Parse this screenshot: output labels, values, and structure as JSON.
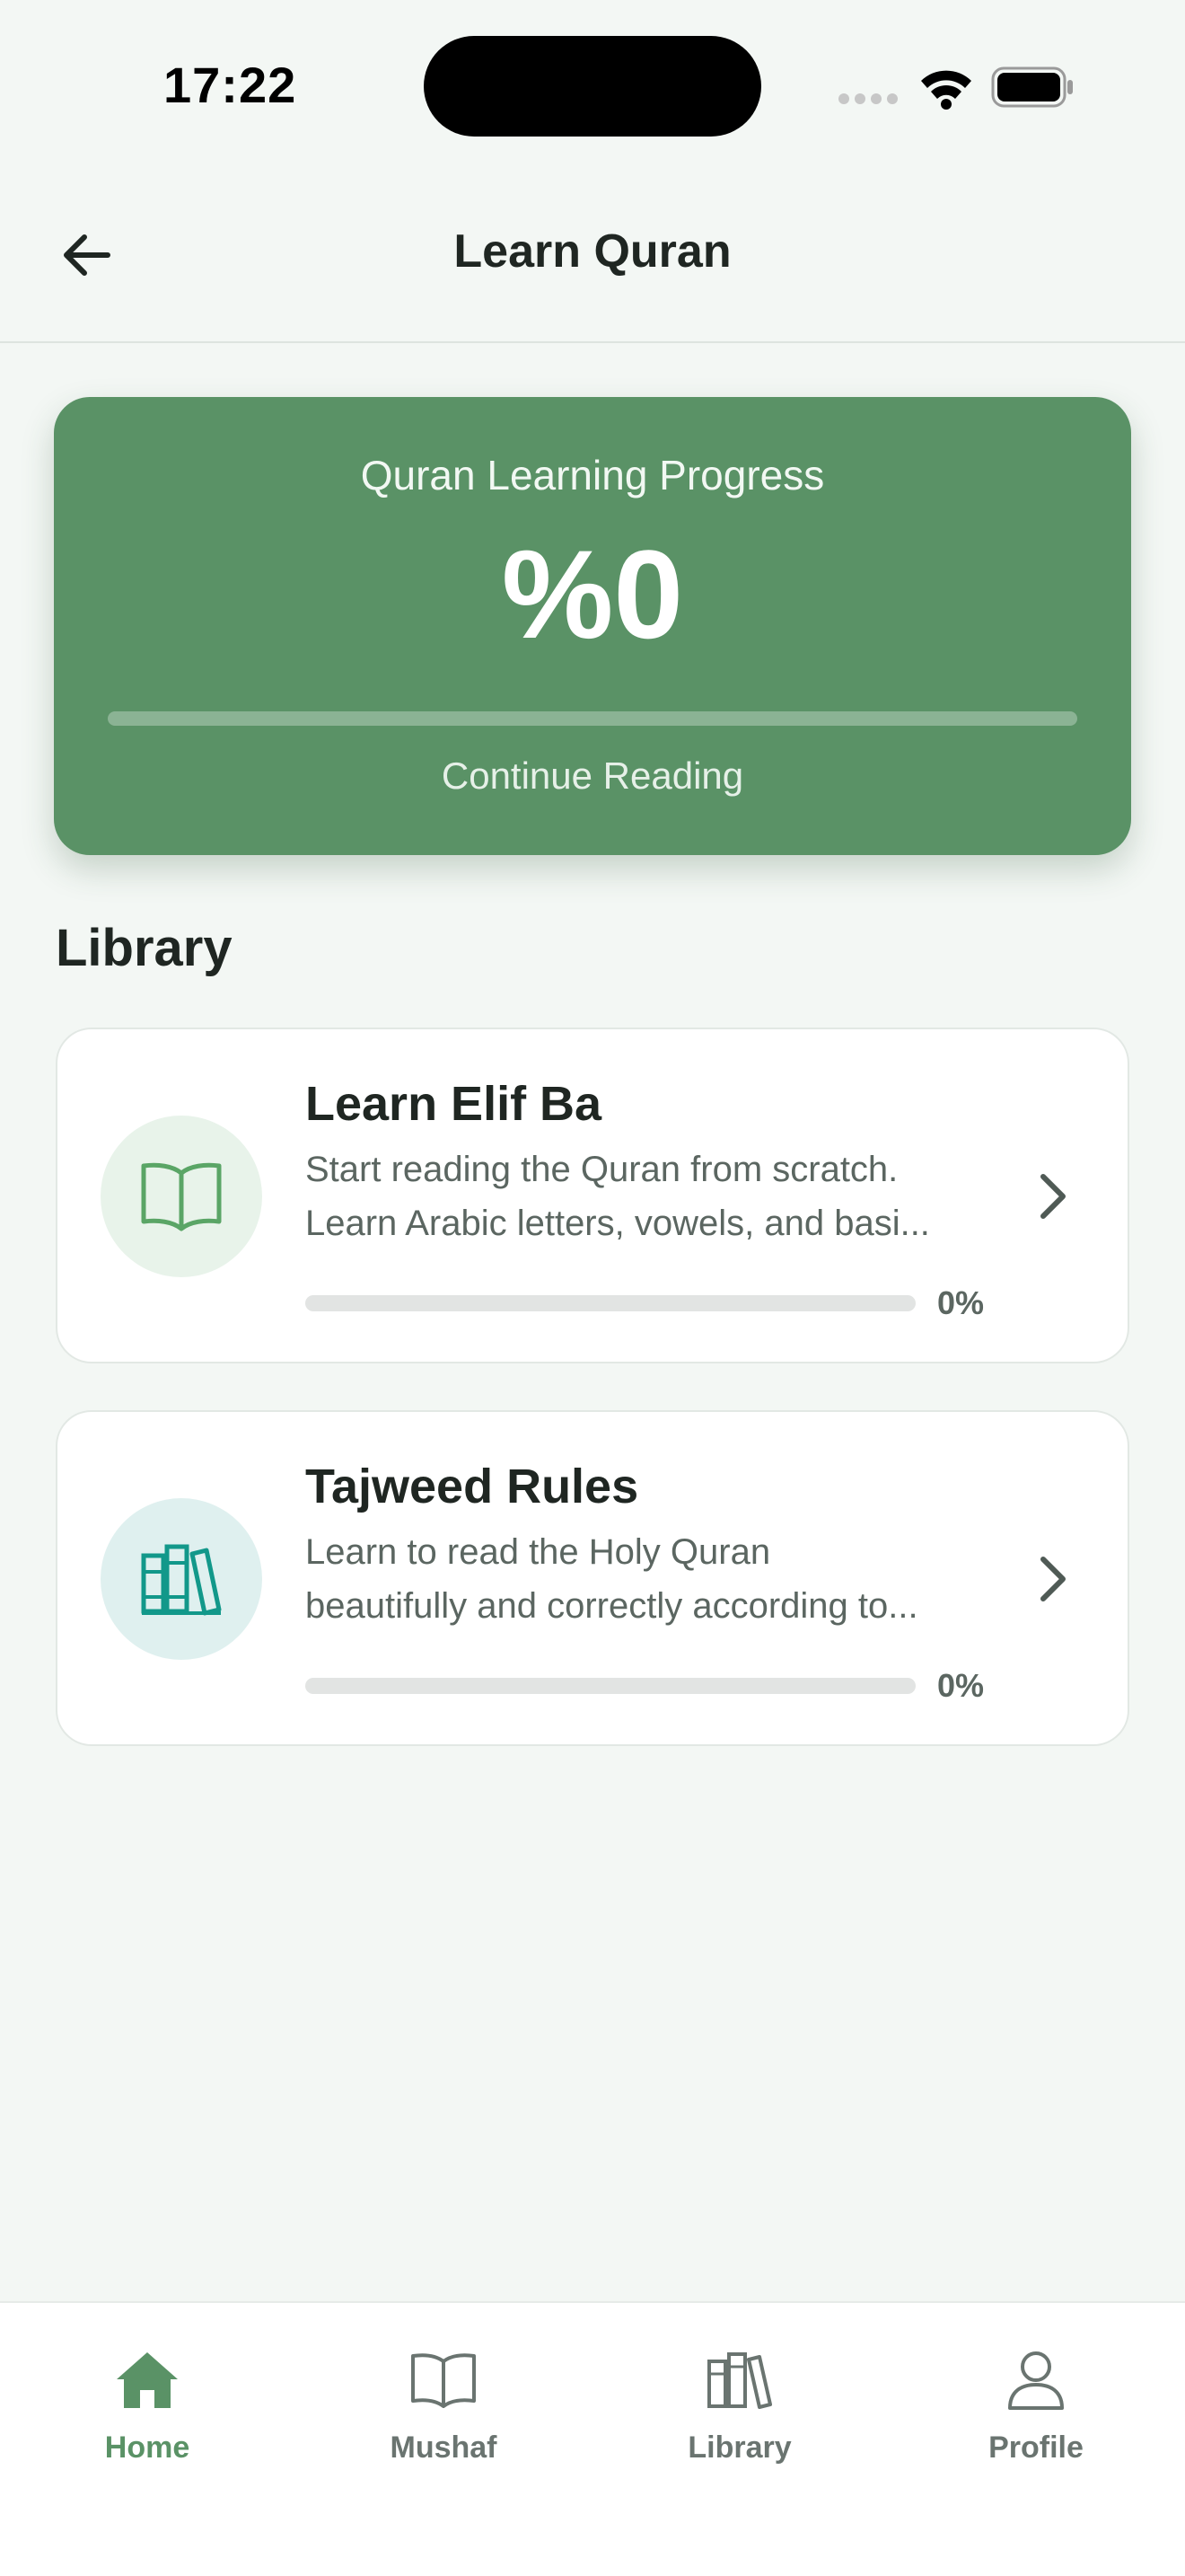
{
  "status_bar": {
    "time": "17:22",
    "icons": [
      "signal-icon",
      "wifi-icon",
      "battery-icon"
    ]
  },
  "header": {
    "back_icon": "arrow-left-icon",
    "title": "Learn Quran"
  },
  "progress_card": {
    "title": "Quran Learning Progress",
    "percent_label": "%0",
    "progress_fraction": 0,
    "action_label": "Continue Reading",
    "background_color": "#5a9266"
  },
  "library": {
    "heading": "Library",
    "courses": [
      {
        "title": "Learn Elif Ba",
        "description_line1": "Start reading the Quran from scratch.",
        "description_line2": "Learn Arabic letters, vowels, and basi...",
        "percent_label": "0%",
        "progress_fraction": 0,
        "icon": "open-book-icon",
        "icon_color": "#5aa566"
      },
      {
        "title": "Tajweed Rules",
        "description_line1": "Learn to read the Holy Quran",
        "description_line2": "beautifully and correctly according to...",
        "percent_label": "0%",
        "progress_fraction": 0,
        "icon": "books-icon",
        "icon_color": "#12988a"
      }
    ]
  },
  "bottom_nav": {
    "items": [
      {
        "label": "Home",
        "icon": "home-icon",
        "active": true
      },
      {
        "label": "Mushaf",
        "icon": "open-book-icon",
        "active": false
      },
      {
        "label": "Library",
        "icon": "books-icon",
        "active": false
      },
      {
        "label": "Profile",
        "icon": "user-icon",
        "active": false
      }
    ],
    "active_color": "#5a9266",
    "inactive_color": "#6a7470"
  }
}
